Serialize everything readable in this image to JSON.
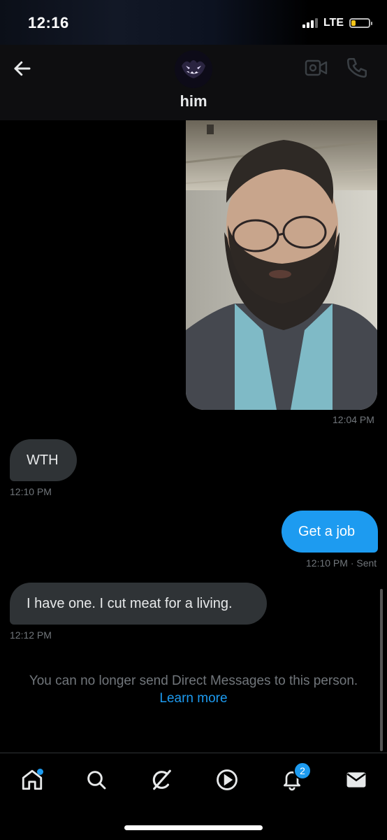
{
  "status_bar": {
    "time": "12:16",
    "network": "LTE"
  },
  "header": {
    "title": "him",
    "icons": [
      "back-arrow-icon",
      "video-call-icon",
      "phone-call-icon"
    ]
  },
  "messages": [
    {
      "type": "media",
      "direction": "received",
      "timestamp": "12:04 PM"
    },
    {
      "type": "text",
      "direction": "received",
      "text": "WTH",
      "timestamp": "12:10 PM"
    },
    {
      "type": "text",
      "direction": "sent",
      "text": "Get a job",
      "timestamp": "12:10 PM",
      "status": "· Sent"
    },
    {
      "type": "text",
      "direction": "received",
      "text": "I have one. I cut meat for a living.",
      "timestamp": "12:12 PM"
    }
  ],
  "notice": {
    "text": "You can no longer send Direct Messages to this person.",
    "link": "Learn more"
  },
  "bottom_nav": {
    "items": [
      "home-icon",
      "search-icon",
      "grok-icon",
      "video-icon",
      "notifications-icon",
      "messages-icon"
    ],
    "notification_count": "2"
  },
  "colors": {
    "accent": "#1d9bf0",
    "received_bubble": "#2f3336",
    "muted_text": "#71767b"
  }
}
